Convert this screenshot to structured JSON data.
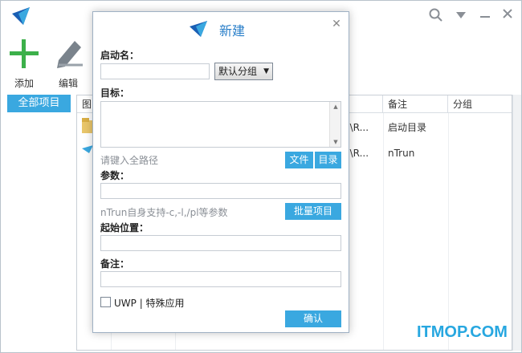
{
  "app": {
    "toolbar": {
      "add_label": "添加",
      "edit_label": "编辑"
    },
    "group_button_label": "全部项目",
    "columns": [
      "图",
      "",
      "",
      "",
      "备注",
      "分组"
    ],
    "rows": [
      {
        "path": "p\\R...",
        "note": "启动目录",
        "group": ""
      },
      {
        "path": "p\\R...",
        "note": "nTrun",
        "group": ""
      }
    ],
    "icons": {
      "app_logo": "ntrun-logo-icon",
      "search": "search-icon",
      "dropdown": "chevron-down-icon",
      "minimize": "minimize-icon",
      "close": "close-icon",
      "add": "plus-icon",
      "edit": "pencil-icon"
    },
    "colors": {
      "accent": "#3aa8e0",
      "logo_dark": "#1a5fb4",
      "add_green": "#3cb04a"
    }
  },
  "dialog": {
    "title": "新建",
    "name_label": "启动名：",
    "name_value": "",
    "group_select": "默认分组",
    "target_label": "目标：",
    "target_hint": "请键入全路径",
    "file_button": "文件",
    "dir_button": "目录",
    "params_label": "参数：",
    "params_hint": "nTrun自身支持-c,-l,/pl等参数",
    "batch_button": "批量项目",
    "start_label": "起始位置：",
    "note_label": "备注：",
    "uwp_label": "UWP | 特殊应用",
    "confirm_button": "确认"
  },
  "watermark": "ITMOP.COM"
}
